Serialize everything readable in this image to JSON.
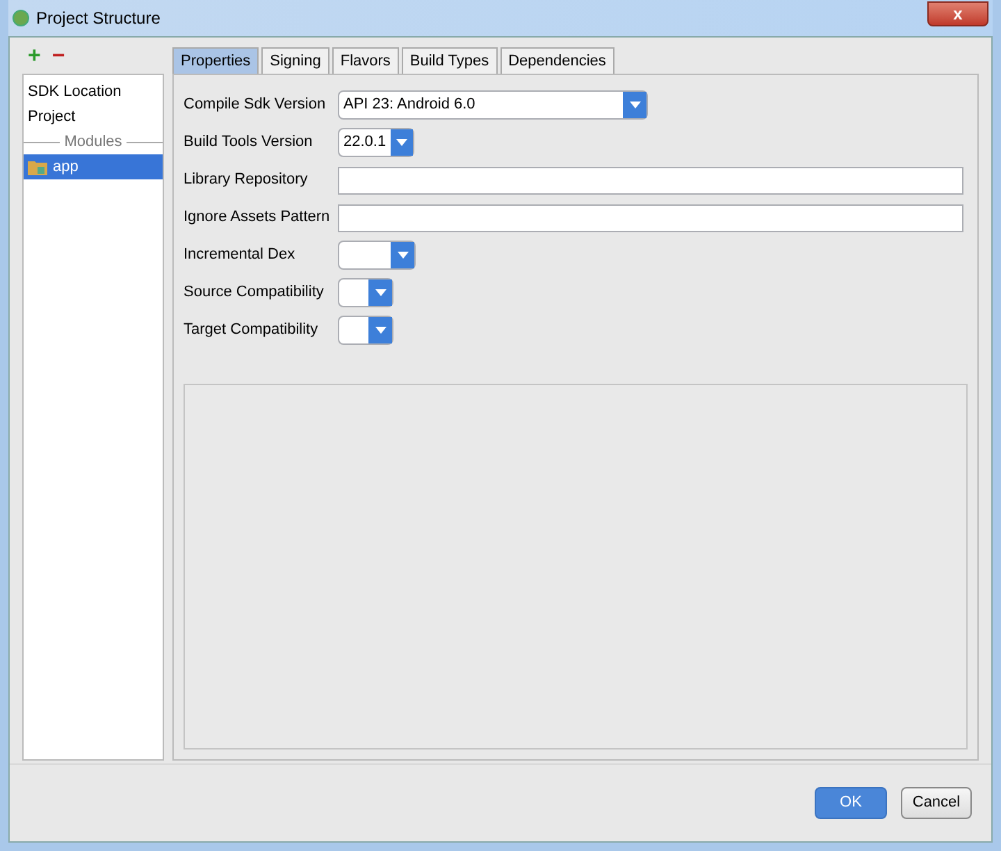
{
  "window": {
    "title": "Project Structure",
    "close": "x"
  },
  "toolbar": {
    "add": "+",
    "remove": "−"
  },
  "sidebar": {
    "items": [
      {
        "label": "SDK Location",
        "selected": false
      },
      {
        "label": "Project",
        "selected": false
      }
    ],
    "section": "Modules",
    "modules": [
      {
        "label": "app",
        "selected": true
      }
    ]
  },
  "tabs": [
    {
      "label": "Properties",
      "selected": true
    },
    {
      "label": "Signing",
      "selected": false
    },
    {
      "label": "Flavors",
      "selected": false
    },
    {
      "label": "Build Types",
      "selected": false
    },
    {
      "label": "Dependencies",
      "selected": false
    }
  ],
  "fields": [
    {
      "label": "Compile Sdk Version",
      "kind": "combo",
      "value": "API 23: Android 6.0"
    },
    {
      "label": "Build Tools Version",
      "kind": "combo",
      "value": "22.0.1"
    },
    {
      "label": "Library Repository",
      "kind": "text"
    },
    {
      "label": "Ignore Assets Pattern",
      "kind": "text"
    },
    {
      "label": "Incremental Dex",
      "kind": "combo"
    },
    {
      "label": "Source Compatibility",
      "kind": "combo"
    },
    {
      "label": "Target Compatibility",
      "kind": "combo"
    }
  ],
  "buttons": [
    {
      "label": "OK",
      "kind": "primary"
    },
    {
      "label": "Cancel",
      "kind": "secondary"
    }
  ]
}
